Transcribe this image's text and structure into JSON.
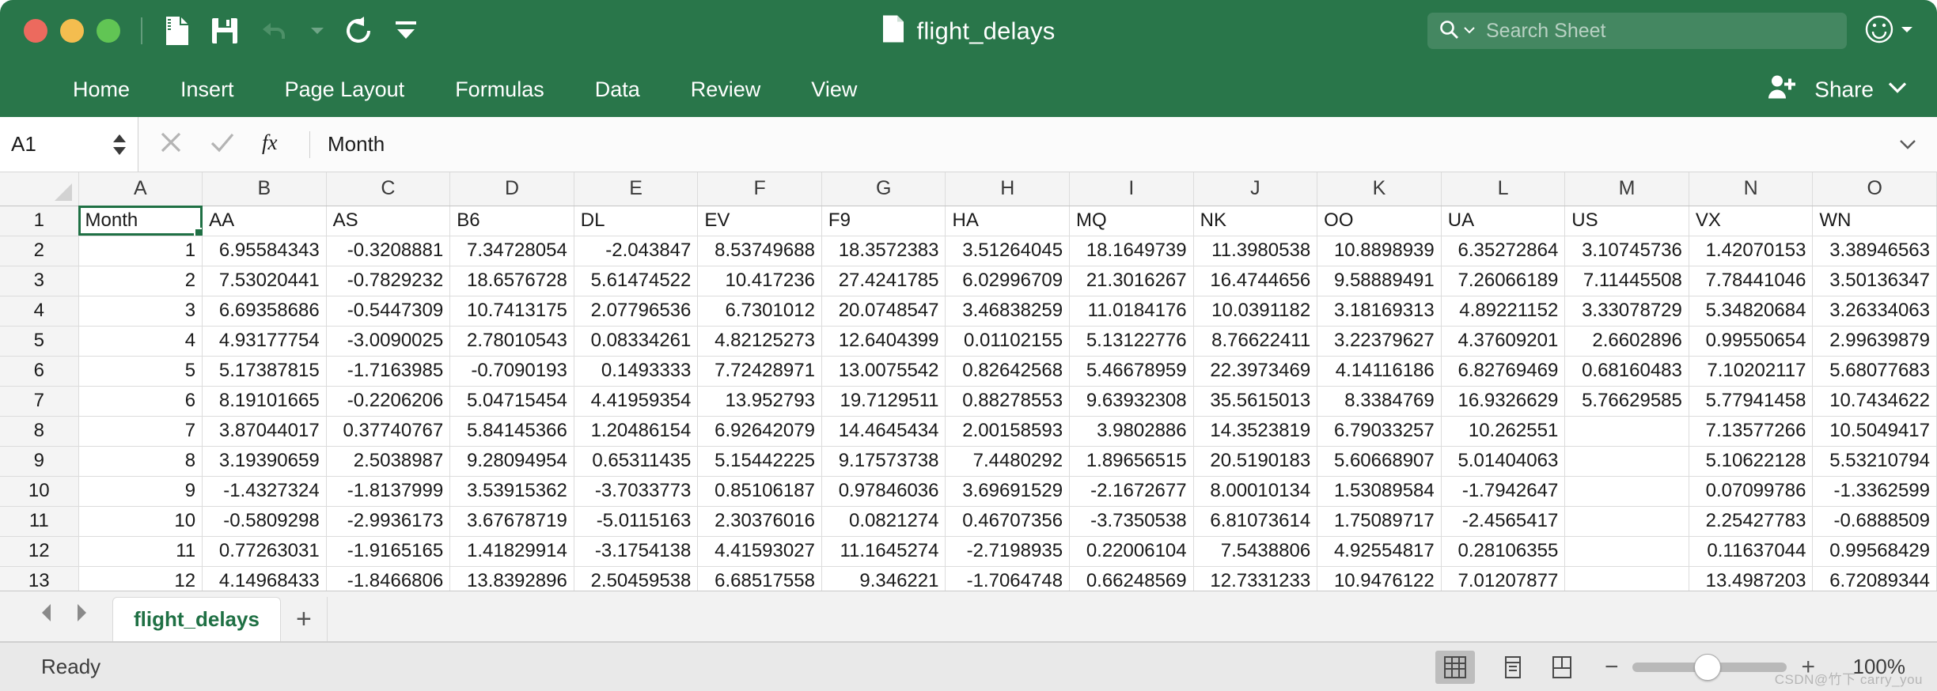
{
  "window": {
    "title": "flight_delays",
    "traffic_lights": [
      "close",
      "minimize",
      "maximize"
    ],
    "colors": {
      "brand_green": "#29764a",
      "tab_text_green": "#1f7044",
      "selection_green": "#1f7044",
      "close_red": "#ec6a5e",
      "min_yellow": "#f4bd4f",
      "max_green": "#61c554"
    }
  },
  "quick_access": [
    {
      "name": "new-document-icon",
      "label": "New"
    },
    {
      "name": "save-icon",
      "label": "Save"
    },
    {
      "name": "undo-icon",
      "label": "Undo"
    },
    {
      "name": "undo-dropdown-icon",
      "label": "Undo options"
    },
    {
      "name": "redo-icon",
      "label": "Redo"
    },
    {
      "name": "customize-toolbar-icon",
      "label": "Customize"
    }
  ],
  "search": {
    "placeholder": "Search Sheet",
    "icon": "search-icon",
    "dropdown_icon": "chevron-down-icon"
  },
  "smiley": {
    "icon": "smiley-icon",
    "dropdown_icon": "chevron-down-icon"
  },
  "ribbon": {
    "tabs": [
      {
        "label": "Home"
      },
      {
        "label": "Insert"
      },
      {
        "label": "Page Layout"
      },
      {
        "label": "Formulas"
      },
      {
        "label": "Data"
      },
      {
        "label": "Review"
      },
      {
        "label": "View"
      }
    ],
    "active_tab": "Home",
    "share": {
      "label": "Share",
      "icon": "person-add-icon",
      "dropdown_icon": "chevron-down-icon"
    }
  },
  "formula_bar": {
    "name_box_value": "A1",
    "cancel_icon": "close-icon",
    "confirm_icon": "check-icon",
    "function_icon": "fx-icon",
    "content": "Month",
    "expand_icon": "chevron-down-icon"
  },
  "grid": {
    "column_letters": [
      "A",
      "B",
      "C",
      "D",
      "E",
      "F",
      "G",
      "H",
      "I",
      "J",
      "K",
      "L",
      "M",
      "N",
      "O"
    ],
    "row_numbers": [
      1,
      2,
      3,
      4,
      5,
      6,
      7,
      8,
      9,
      10,
      11,
      12,
      13
    ],
    "selected_cell": "A1",
    "rows": [
      [
        "Month",
        "AA",
        "AS",
        "B6",
        "DL",
        "EV",
        "F9",
        "HA",
        "MQ",
        "NK",
        "OO",
        "UA",
        "US",
        "VX",
        "WN"
      ],
      [
        "1",
        "6.95584343",
        "-0.3208881",
        "7.34728054",
        "-2.043847",
        "8.53749688",
        "18.3572383",
        "3.51264045",
        "18.1649739",
        "11.3980538",
        "10.8898939",
        "6.35272864",
        "3.10745736",
        "1.42070153",
        "3.38946563"
      ],
      [
        "2",
        "7.53020441",
        "-0.7829232",
        "18.6576728",
        "5.61474522",
        "10.417236",
        "27.4241785",
        "6.02996709",
        "21.3016267",
        "16.4744656",
        "9.58889491",
        "7.26066189",
        "7.11445508",
        "7.78441046",
        "3.50136347"
      ],
      [
        "3",
        "6.69358686",
        "-0.5447309",
        "10.7413175",
        "2.07796536",
        "6.7301012",
        "20.0748547",
        "3.46838259",
        "11.0184176",
        "10.0391182",
        "3.18169313",
        "4.89221152",
        "3.33078729",
        "5.34820684",
        "3.26334063"
      ],
      [
        "4",
        "4.93177754",
        "-3.0090025",
        "2.78010543",
        "0.08334261",
        "4.82125273",
        "12.6404399",
        "0.01102155",
        "5.13122776",
        "8.76622411",
        "3.22379627",
        "4.37609201",
        "2.6602896",
        "0.99550654",
        "2.99639879"
      ],
      [
        "5",
        "5.17387815",
        "-1.7163985",
        "-0.7090193",
        "0.1493333",
        "7.72428971",
        "13.0075542",
        "0.82642568",
        "5.46678959",
        "22.3973469",
        "4.14116186",
        "6.82769469",
        "0.68160483",
        "7.10202117",
        "5.68077683"
      ],
      [
        "6",
        "8.19101665",
        "-0.2206206",
        "5.04715454",
        "4.41959354",
        "13.952793",
        "19.7129511",
        "0.88278553",
        "9.63932308",
        "35.5615013",
        "8.3384769",
        "16.9326629",
        "5.76629585",
        "5.77941458",
        "10.7434622"
      ],
      [
        "7",
        "3.87044017",
        "0.37740767",
        "5.84145366",
        "1.20486154",
        "6.92642079",
        "14.4645434",
        "2.00158593",
        "3.9802886",
        "14.3523819",
        "6.79033257",
        "10.262551",
        "",
        "7.13577266",
        "10.5049417"
      ],
      [
        "8",
        "3.19390659",
        "2.5038987",
        "9.28094954",
        "0.65311435",
        "5.15442225",
        "9.17573738",
        "7.4480292",
        "1.89656515",
        "20.5190183",
        "5.60668907",
        "5.01404063",
        "",
        "5.10622128",
        "5.53210794"
      ],
      [
        "9",
        "-1.4327324",
        "-1.8137999",
        "3.53915362",
        "-3.7033773",
        "0.85106187",
        "0.97846036",
        "3.69691529",
        "-2.1672677",
        "8.00010134",
        "1.53089584",
        "-1.7942647",
        "",
        "0.07099786",
        "-1.3362599"
      ],
      [
        "10",
        "-0.5809298",
        "-2.9936173",
        "3.67678719",
        "-5.0115163",
        "2.30376016",
        "0.0821274",
        "0.46707356",
        "-3.7350538",
        "6.81073614",
        "1.75089717",
        "-2.4565417",
        "",
        "2.25427783",
        "-0.6888509"
      ],
      [
        "11",
        "0.77263031",
        "-1.9165165",
        "1.41829914",
        "-3.1754138",
        "4.41593027",
        "11.1645274",
        "-2.7198935",
        "0.22006104",
        "7.5438806",
        "4.92554817",
        "0.28106355",
        "",
        "0.11637044",
        "0.99568429"
      ],
      [
        "12",
        "4.14968433",
        "-1.8466806",
        "13.8392896",
        "2.50459538",
        "6.68517558",
        "9.346221",
        "-1.7064748",
        "0.66248569",
        "12.7331233",
        "10.9476122",
        "7.01207877",
        "",
        "13.4987203",
        "6.72089344"
      ]
    ]
  },
  "sheet_tabs": {
    "prev_icon": "chevron-left-icon",
    "next_icon": "chevron-right-icon",
    "tabs": [
      {
        "label": "flight_delays",
        "active": true
      }
    ],
    "add_label": "+"
  },
  "status_bar": {
    "status": "Ready",
    "view_buttons": [
      {
        "name": "normal-view-icon",
        "active": true
      },
      {
        "name": "page-layout-view-icon",
        "active": false
      },
      {
        "name": "page-break-view-icon",
        "active": false
      }
    ],
    "zoom_out_label": "−",
    "zoom_in_label": "+",
    "zoom_level": "100%"
  },
  "watermark": "CSDN@竹下 carry_you"
}
